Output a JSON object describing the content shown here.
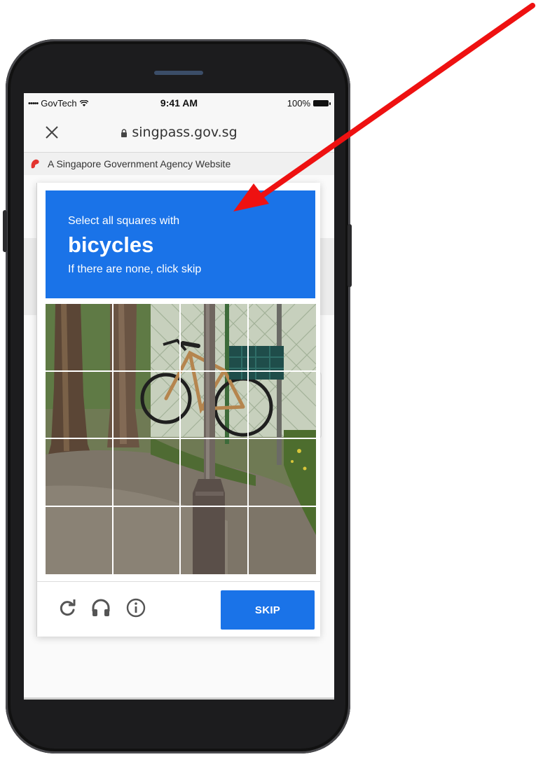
{
  "status_bar": {
    "signal": "•••••",
    "carrier": "GovTech",
    "time": "9:41 AM",
    "battery": "100%"
  },
  "browser": {
    "url": "singpass.gov.sg"
  },
  "gov_banner": {
    "text": "A Singapore Government Agency Website"
  },
  "captcha": {
    "instruction": "Select all squares with",
    "target": "bicycles",
    "hint": "If there are none, click skip",
    "grid": {
      "rows": 4,
      "columns": 4
    },
    "skip_label": "SKIP"
  },
  "icons": {
    "close": "close-icon",
    "lock": "lock-icon",
    "reload": "reload-icon",
    "audio": "headphones-icon",
    "info": "info-icon"
  },
  "colors": {
    "accent": "#1a73e8",
    "annotation_arrow": "#ee1111"
  }
}
